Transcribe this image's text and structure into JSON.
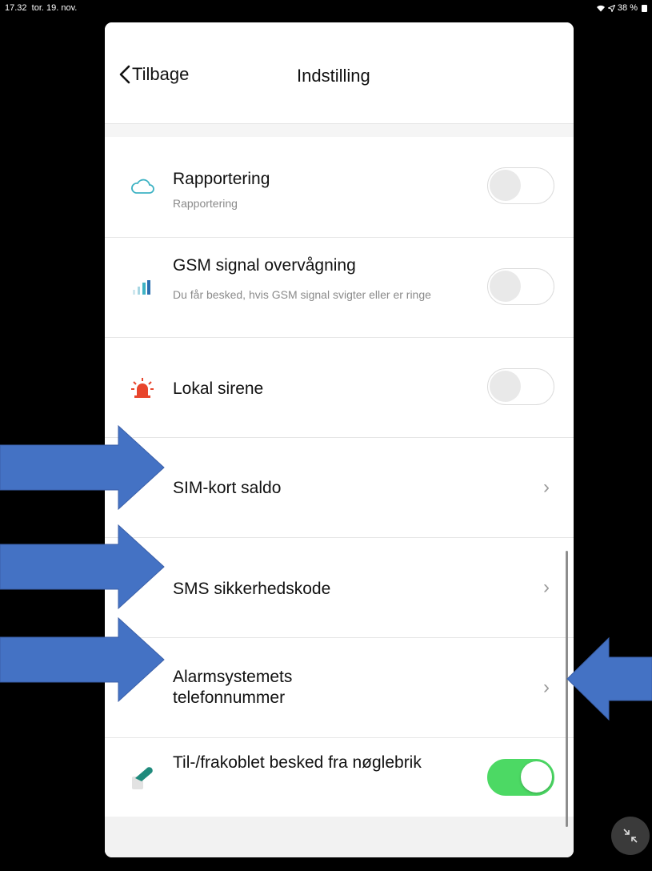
{
  "status_bar": {
    "time": "17.32",
    "date": "tor. 19. nov.",
    "battery": "38 %"
  },
  "nav": {
    "back_label": "Tilbage",
    "title": "Indstilling"
  },
  "settings": [
    {
      "title": "Rapportering",
      "subtitle": "Rapportering",
      "control": "toggle",
      "on": false,
      "icon": "cloud-icon"
    },
    {
      "title": "GSM signal overvågning",
      "subtitle": "Du får besked, hvis GSM signal svigter eller er ringe",
      "control": "toggle",
      "on": false,
      "icon": "signal-bars-icon"
    },
    {
      "title": "Lokal sirene",
      "control": "toggle",
      "on": false,
      "icon": "siren-icon"
    },
    {
      "title": "SIM-kort saldo",
      "control": "chevron"
    },
    {
      "title": "SMS sikkerhedskode",
      "control": "chevron"
    },
    {
      "title": "Alarmsystemets telefonnummer",
      "control": "chevron"
    },
    {
      "title": "Til-/frakoblet besked fra nøglebrik",
      "control": "toggle",
      "on": true,
      "icon": "key-fob-icon"
    }
  ],
  "colors": {
    "toggle_on": "#4cd964",
    "annotation_arrow": "#4472c4",
    "siren": "#e8452c",
    "cloud": "#3fb3c4",
    "key_fob": "#1f8a7c"
  }
}
